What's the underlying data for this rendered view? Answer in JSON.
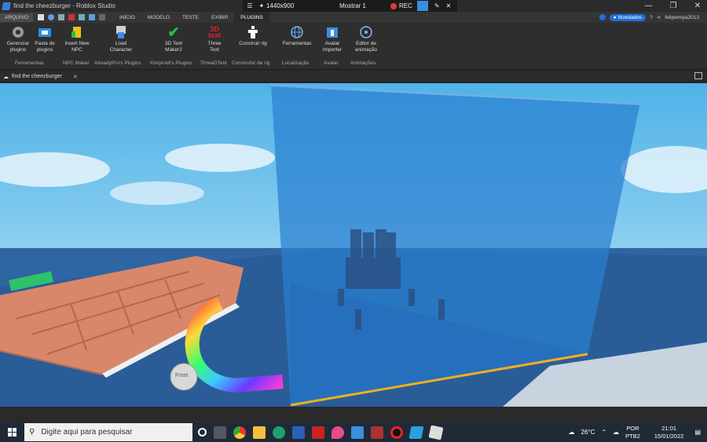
{
  "window": {
    "title": "find the cheezburger - Roblox Studio"
  },
  "recorder": {
    "resolution": "1440x900",
    "display": "Mostrar 1",
    "rec_label": "REC"
  },
  "window_controls": {
    "minimize": "—",
    "restore": "❐",
    "close": "✕"
  },
  "menu": {
    "file": "ARQUIVO",
    "tabs": [
      "INÍCIO",
      "MODELO",
      "TESTE",
      "EXIBIR",
      "PLUGINS"
    ],
    "active_tab": "PLUGINS",
    "novidades": "Novidades",
    "username": "felipemiya2013"
  },
  "ribbon": {
    "buttons": [
      {
        "label": "Gerenciar plugins",
        "icon": "gear-icon"
      },
      {
        "label": "Pasta de plugins",
        "icon": "folder-icon"
      },
      {
        "label": "Insert New NPC",
        "icon": "npc-icon"
      },
      {
        "label": "Load Character",
        "icon": "character-icon"
      },
      {
        "label": "3D Text Maker2",
        "icon": "checkmark-icon"
      },
      {
        "label": "Three Text",
        "icon": "3d-text-icon"
      },
      {
        "label": "Construir rig",
        "icon": "rig-icon"
      },
      {
        "label": "Ferramentas",
        "icon": "globe-icon"
      },
      {
        "label": "Avatar Importer",
        "icon": "avatar-import-icon"
      },
      {
        "label": "Editor de animação",
        "icon": "animation-icon"
      }
    ],
    "groups": [
      "Ferramentas",
      "NPC Maker",
      "AlreadyPro's Plugins",
      "KinqAndi's Plugins",
      "ThreeDText",
      "Construtor de rig",
      "Localização",
      "Avatar",
      "Animações"
    ]
  },
  "document": {
    "tab": "find the cheezburger",
    "close": "✕"
  },
  "viewport": {
    "front_label": "Front"
  },
  "taskbar": {
    "search_placeholder": "Digite aqui para pesquisar",
    "weather": "26°C",
    "lang_1": "POR",
    "lang_2": "PTB2",
    "time": "21:01",
    "date": "15/01/2022"
  },
  "colors": {
    "accent": "#1e6fd9",
    "water": "#2a7fd0",
    "maze": "#d98a6a"
  }
}
